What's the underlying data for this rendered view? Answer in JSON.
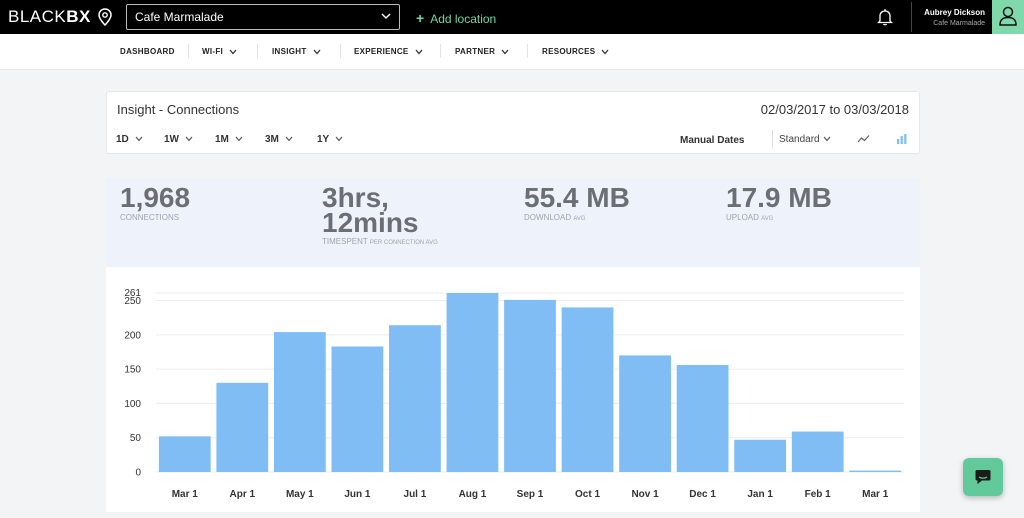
{
  "brand": {
    "thin": "BLACK",
    "bold": "BX"
  },
  "location": {
    "selected": "Cafe Marmalade",
    "add_label": "Add location"
  },
  "user": {
    "name": "Aubrey Dickson",
    "venue": "Cafe Marmalade"
  },
  "nav": [
    {
      "label": "DASHBOARD"
    },
    {
      "label": "WI-FI"
    },
    {
      "label": "INSIGHT"
    },
    {
      "label": "EXPERIENCE"
    },
    {
      "label": "PARTNER"
    },
    {
      "label": "RESOURCES"
    }
  ],
  "insight": {
    "title": "Insight - Connections",
    "date_range": "02/03/2017 to 03/03/2018",
    "ranges": [
      {
        "label": "1D"
      },
      {
        "label": "1W"
      },
      {
        "label": "1M"
      },
      {
        "label": "3M"
      },
      {
        "label": "1Y"
      }
    ],
    "manual_dates": "Manual Dates",
    "view_mode": "Standard"
  },
  "stats": [
    {
      "value": "1,968",
      "label": "CONNECTIONS",
      "sub": ""
    },
    {
      "value_line1": "3hrs,",
      "value_line2": "12mins",
      "label": "TIMESPENT",
      "sub": "PER CONNECTION AVG"
    },
    {
      "value": "55.4 MB",
      "label": "DOWNLOAD",
      "sub": "AVG"
    },
    {
      "value": "17.9 MB",
      "label": "UPLOAD",
      "sub": "AVG"
    }
  ],
  "chart_data": {
    "type": "bar",
    "categories": [
      "Mar 1",
      "Apr 1",
      "May 1",
      "Jun 1",
      "Jul 1",
      "Aug 1",
      "Sep 1",
      "Oct 1",
      "Nov 1",
      "Dec 1",
      "Jan 1",
      "Feb 1",
      "Mar 1"
    ],
    "values": [
      52,
      130,
      204,
      183,
      214,
      261,
      251,
      240,
      170,
      156,
      47,
      59,
      2
    ],
    "yticks": [
      0,
      50,
      100,
      150,
      200,
      250
    ],
    "ymax_label": "261",
    "ylim": [
      0,
      261
    ],
    "bar_color": "#7fbdf4",
    "grid": true
  },
  "colors": {
    "accent": "#6fd8a4",
    "topbar": "#000000",
    "bar": "#7fbdf4",
    "stats_bg": "#eef3fb"
  }
}
